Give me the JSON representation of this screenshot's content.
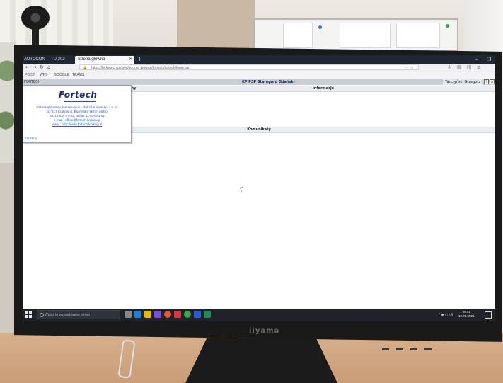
{
  "browser": {
    "pinned_tab_label": "AUTOCON",
    "tabs": [
      {
        "label": "TU.202",
        "active": false
      },
      {
        "label": "Strona główna",
        "active": true
      }
    ],
    "url": "https://fe.fortech.pl/swd/strona_glowna/fortech/fortech/login.jsp",
    "url_tail": "··· ☆",
    "bookmarks": [
      {
        "label": "POCZ"
      },
      {
        "label": "WPS"
      },
      {
        "label": "GOOGLE"
      },
      {
        "label": "TEAMS"
      }
    ]
  },
  "app": {
    "left_label": "FORTECH",
    "unit": "KP PSP Starogard Gdański",
    "user": "Tarczyński Grzegorz",
    "col_label": "my",
    "sections": {
      "informacje": "Informacje",
      "komunikaty": "Komunikaty"
    }
  },
  "popup": {
    "logo": "Fortech",
    "lines": [
      "Przedsiębiorstwo Innowacyjno - Wdrożeniowe sp. z o. o.",
      "31-817 Kraków ul. Bochenka 5B/VII piętro",
      "tel. 12 634-44-83, tel/fax 12 634-81-91",
      "e-mail : office@fortech.krakow.pl",
      "www : http://www.fortech.krakow.pl"
    ],
    "close": "zamknij"
  },
  "taskbar": {
    "search_placeholder": "Wpisz tu wyszukiwane słowo",
    "time": "09:41",
    "date": "10.05.2021"
  },
  "monitor": {
    "brand": "iiyama"
  },
  "colors": {
    "accent_blue": "#1e2f7a",
    "link_blue": "#3b56b8",
    "taskbar": "#1f2228",
    "tabbar": "#1f2735"
  }
}
